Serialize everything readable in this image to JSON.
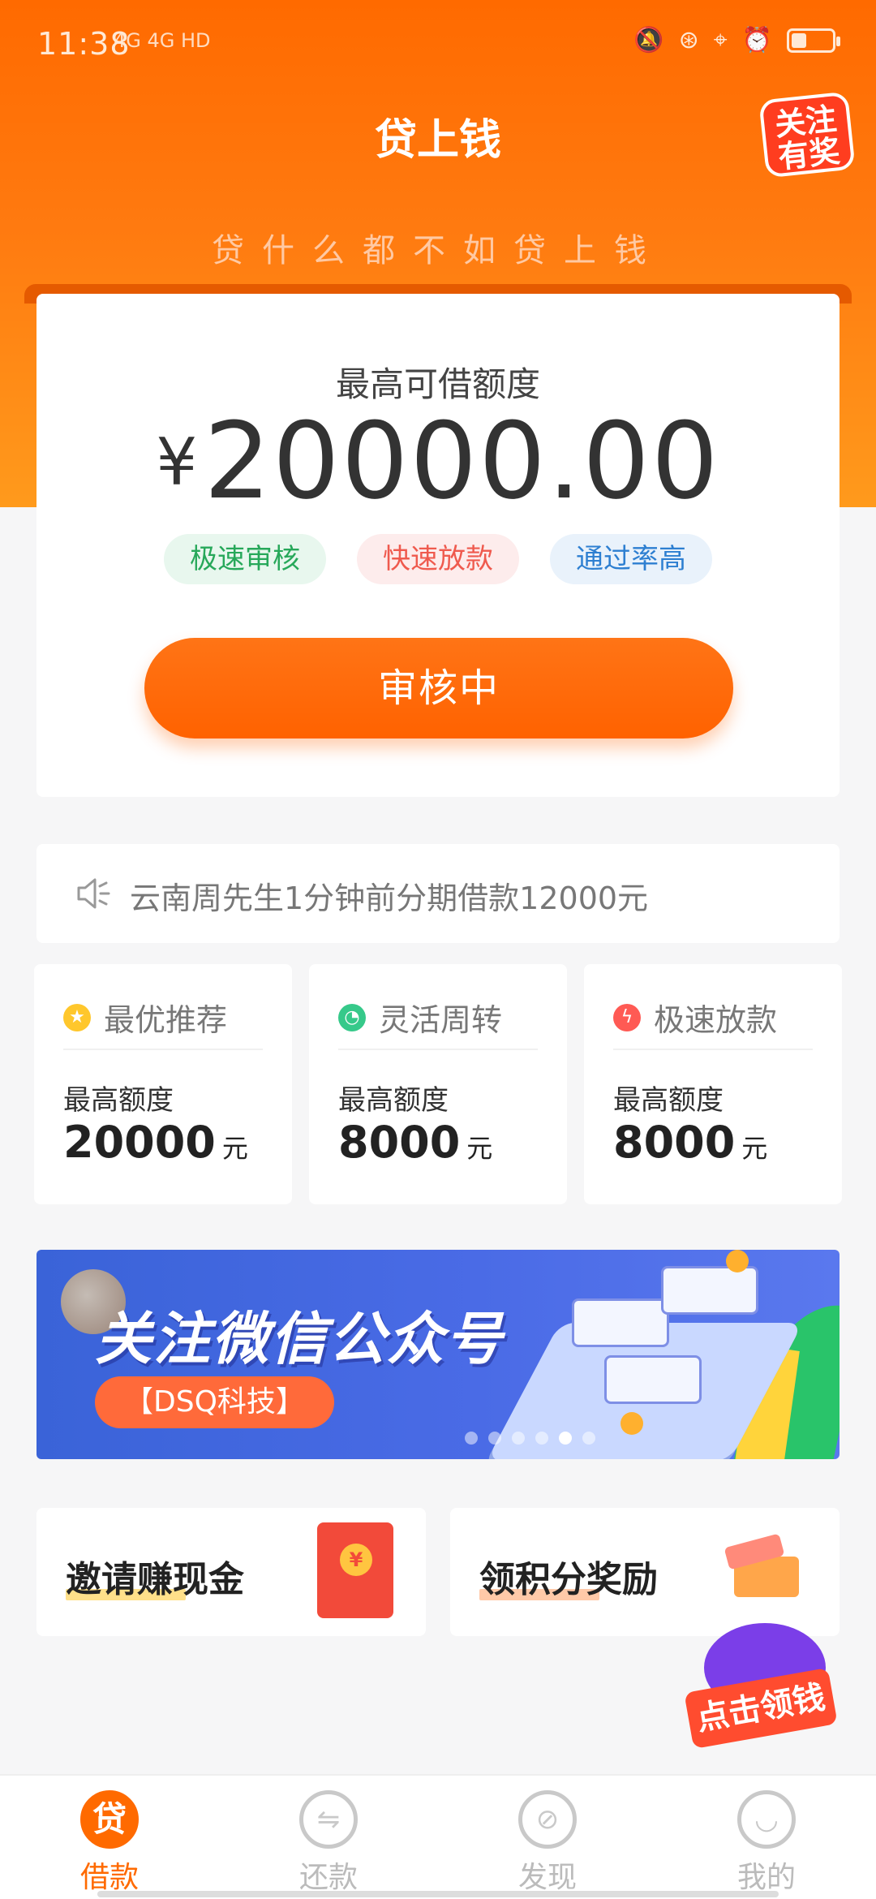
{
  "status": {
    "time": "11:38",
    "network": "4G 4G HD"
  },
  "header": {
    "title": "贷上钱",
    "badge": "关注有奖",
    "slogan": "贷什么都不如贷上钱"
  },
  "loan_card": {
    "limit_label": "最高可借额度",
    "currency": "¥",
    "amount": "20000.00",
    "tags": [
      "极速审核",
      "快速放款",
      "通过率高"
    ],
    "button_label": "审核中"
  },
  "marquee": {
    "text": "云南周先生1分钟前分期借款12000元"
  },
  "products": [
    {
      "name": "最优推荐",
      "label": "最高额度",
      "amount": "20000",
      "unit": "元",
      "icon": "star-icon",
      "color": "#ffc72c"
    },
    {
      "name": "灵活周转",
      "label": "最高额度",
      "amount": "8000",
      "unit": "元",
      "icon": "clock-icon",
      "color": "#36c98a"
    },
    {
      "name": "极速放款",
      "label": "最高额度",
      "amount": "8000",
      "unit": "元",
      "icon": "lightning-icon",
      "color": "#ff5a54"
    }
  ],
  "banner": {
    "title": "关注微信公众号",
    "chip": "【DSQ科技】",
    "active_slide": 5,
    "slide_count": 6
  },
  "rewards": [
    {
      "title": "邀请赚现金",
      "highlight": "#ffe08a"
    },
    {
      "title": "领积分奖励",
      "highlight": "#ffc9a8"
    }
  ],
  "floating_badge": "点击领钱",
  "tabs": [
    {
      "label": "借款",
      "glyph": "贷",
      "active": true
    },
    {
      "label": "还款",
      "glyph": "⇋",
      "active": false
    },
    {
      "label": "发现",
      "glyph": "⊘",
      "active": false
    },
    {
      "label": "我的",
      "glyph": "◡",
      "active": false
    }
  ],
  "colors": {
    "primary": "#ff6a00",
    "background": "#f6f6f7"
  }
}
